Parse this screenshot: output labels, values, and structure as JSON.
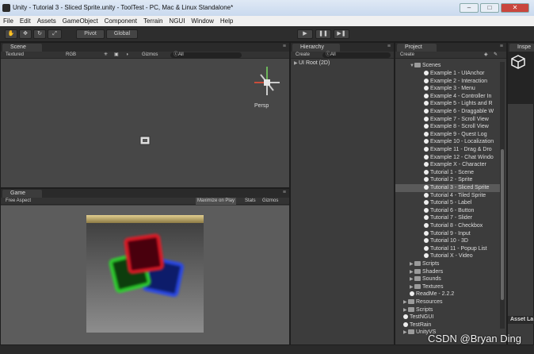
{
  "window": {
    "title": "Unity - Tutorial 3 - Sliced Sprite.unity - ToolTest - PC, Mac & Linux Standalone*"
  },
  "menu": [
    "File",
    "Edit",
    "Assets",
    "GameObject",
    "Component",
    "Terrain",
    "NGUI",
    "Window",
    "Help"
  ],
  "toolbar": {
    "pivot": "Pivot",
    "global": "Global"
  },
  "scene": {
    "tab": "Scene",
    "shading": "Textured",
    "render_mode": "RGB",
    "gizmos": "Gizmos",
    "search": "ⓒAll",
    "persp": "Persp"
  },
  "game": {
    "tab": "Game",
    "aspect": "Free Aspect",
    "maximize": "Maximize on Play",
    "stats": "Stats",
    "gizmos": "Gizmos"
  },
  "hierarchy": {
    "tab": "Hierarchy",
    "create": "Create",
    "search": "ⓒAll",
    "root": "UI Root (2D)"
  },
  "project": {
    "tab": "Project",
    "create": "Create",
    "scenes_folder": "Scenes",
    "scenes": [
      "Example 1 - UIAnchor",
      "Example 2 - Interaction",
      "Example 3 - Menu",
      "Example 4 - Controller In",
      "Example 5 - Lights and R",
      "Example 6 - Draggable W",
      "Example 7 - Scroll View",
      "Example 8 - Scroll View",
      "Example 9 - Quest Log",
      "Example 10 - Localization",
      "Example 11 - Drag & Dro",
      "Example 12 - Chat Windo",
      "Example X - Character",
      "Tutorial 1 - Scene",
      "Tutorial 2 - Sprite",
      "Tutorial 3 - Sliced Sprite",
      "Tutorial 4 - Tiled Sprite",
      "Tutorial 5 - Label",
      "Tutorial 6 - Button",
      "Tutorial 7 - Slider",
      "Tutorial 8 - Checkbox",
      "Tutorial 9 - Input",
      "Tutorial 10 - 3D",
      "Tutorial 11 - Popup List",
      "Tutorial X - Video"
    ],
    "selected_index": 15,
    "more_folders": [
      "Scripts",
      "Shaders",
      "Sounds",
      "Textures"
    ],
    "readme": "ReadMe - 2.2.2",
    "root_folders": [
      "Resources",
      "Scripts"
    ],
    "root_items": [
      "TestNGUI",
      "TestRain"
    ],
    "bottom_folder": "UnityVS"
  },
  "inspector": {
    "tab": "Inspe",
    "label": "Asset La"
  },
  "watermark": "CSDN @Bryan Ding",
  "colors": {
    "selection": "#5a5a5a",
    "panel_bg": "#3c3c3c",
    "game_bg": "#5c5c5c",
    "red_cube": "#d0161e",
    "green_cube": "#1fbf22",
    "blue_cube": "#1f40d8",
    "bar_top": "#c9b375"
  }
}
